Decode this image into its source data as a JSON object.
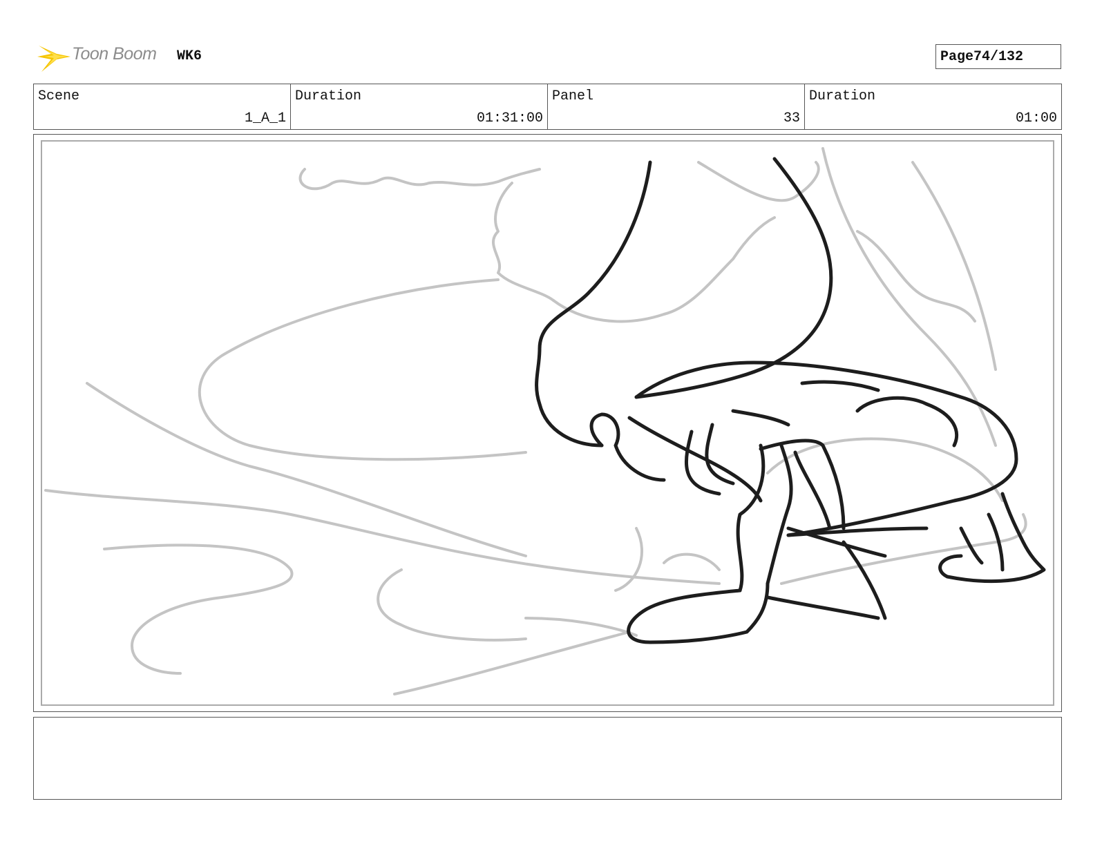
{
  "header": {
    "logo_text": "Toon Boom",
    "project": "WK6",
    "page_label": "Page",
    "page_value": "74/132"
  },
  "info": {
    "scene_label": "Scene",
    "scene_value": "1_A_1",
    "scene_duration_label": "Duration",
    "scene_duration_value": "01:31:00",
    "panel_label": "Panel",
    "panel_value": "33",
    "panel_duration_label": "Duration",
    "panel_duration_value": "01:00"
  },
  "notes": {
    "text": ""
  },
  "colors": {
    "logo_accent": "#f5c400",
    "sketch_dark": "#1a1a1a",
    "sketch_light": "#bdbdbd"
  }
}
